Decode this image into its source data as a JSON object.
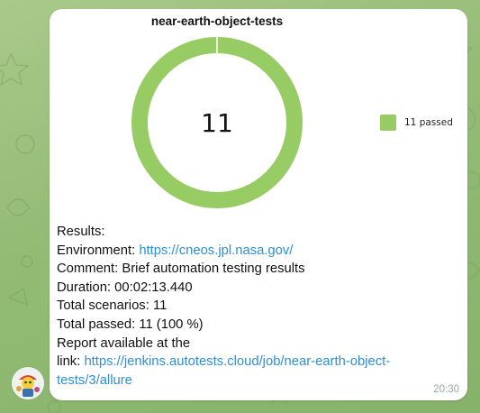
{
  "message": {
    "timestamp": "20:30",
    "results_heading": "Results:",
    "environment": {
      "label": "Environment:",
      "url": "https://cneos.jpl.nasa.gov/"
    },
    "comment": {
      "label": "Comment:",
      "value": "Brief automation testing results"
    },
    "duration": {
      "label": "Duration:",
      "value": "00:02:13.440"
    },
    "total_scenarios": {
      "label": "Total scenarios:",
      "value": "11"
    },
    "total_passed": {
      "label": "Total passed:",
      "value": "11 (100 %)"
    },
    "report": {
      "line1": "Report available at the",
      "label": "link:",
      "url": "https://jenkins.autotests.cloud/job/near-earth-object-tests/3/allure"
    }
  },
  "avatar": {
    "icon": "sender-avatar-icon"
  },
  "colors": {
    "passed": "#97cc64",
    "link": "#2f8ed6",
    "bubble": "#ffffff"
  },
  "chart_data": {
    "type": "pie",
    "title": "near-earth-object-tests",
    "center_label": "11",
    "series": [
      {
        "name": "11 passed",
        "value": 11,
        "color": "#97cc64"
      }
    ],
    "legend_position": "right"
  }
}
